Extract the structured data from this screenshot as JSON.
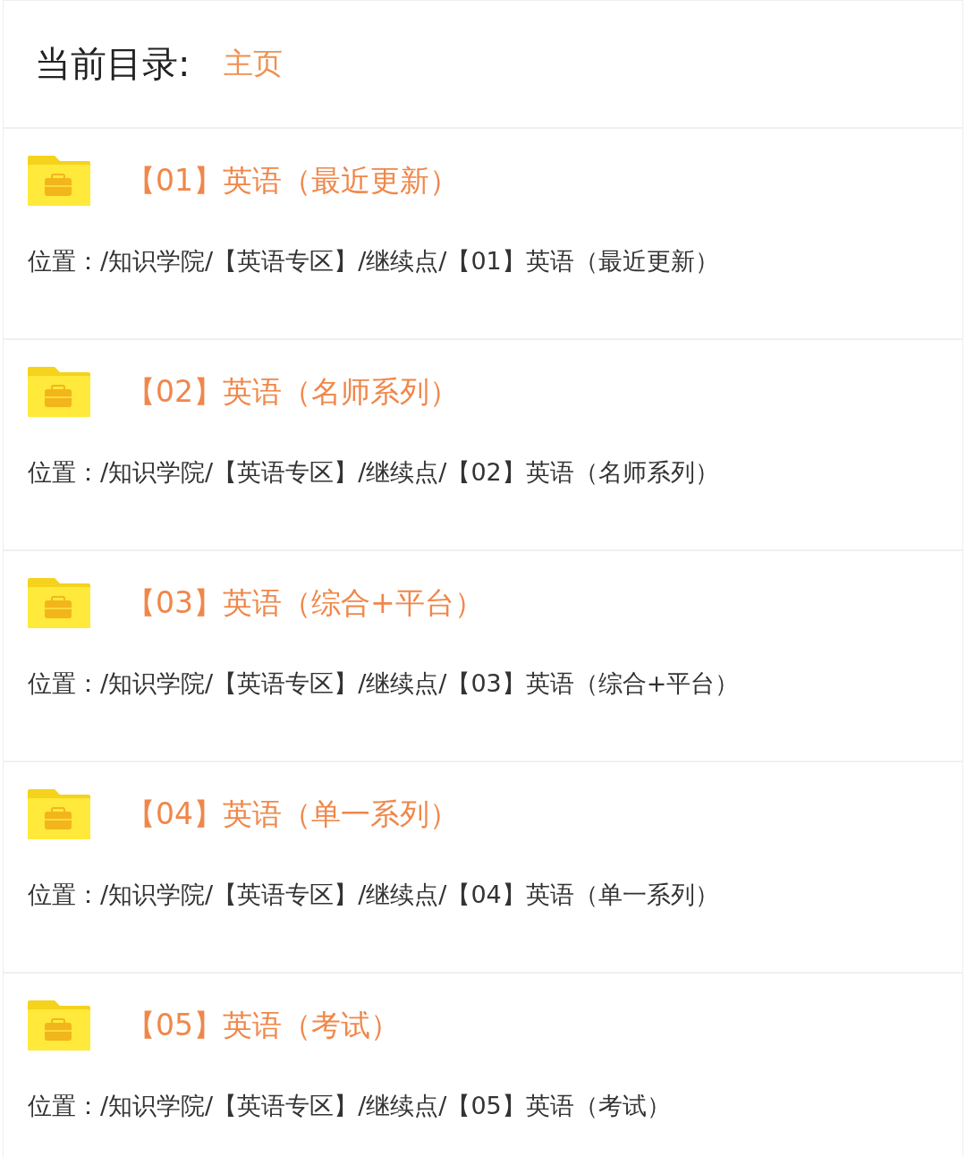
{
  "header": {
    "label": "当前目录:",
    "current": "主页"
  },
  "folders": [
    {
      "title": "【01】英语（最近更新）",
      "path": "位置：/知识学院/【英语专区】/继续点/【01】英语（最近更新）"
    },
    {
      "title": "【02】英语（名师系列）",
      "path": "位置：/知识学院/【英语专区】/继续点/【02】英语（名师系列）"
    },
    {
      "title": "【03】英语（综合+平台）",
      "path": "位置：/知识学院/【英语专区】/继续点/【03】英语（综合+平台）"
    },
    {
      "title": "【04】英语（单一系列）",
      "path": "位置：/知识学院/【英语专区】/继续点/【04】英语（单一系列）"
    },
    {
      "title": "【05】英语（考试）",
      "path": "位置：/知识学院/【英语专区】/继续点/【05】英语（考试）"
    }
  ]
}
